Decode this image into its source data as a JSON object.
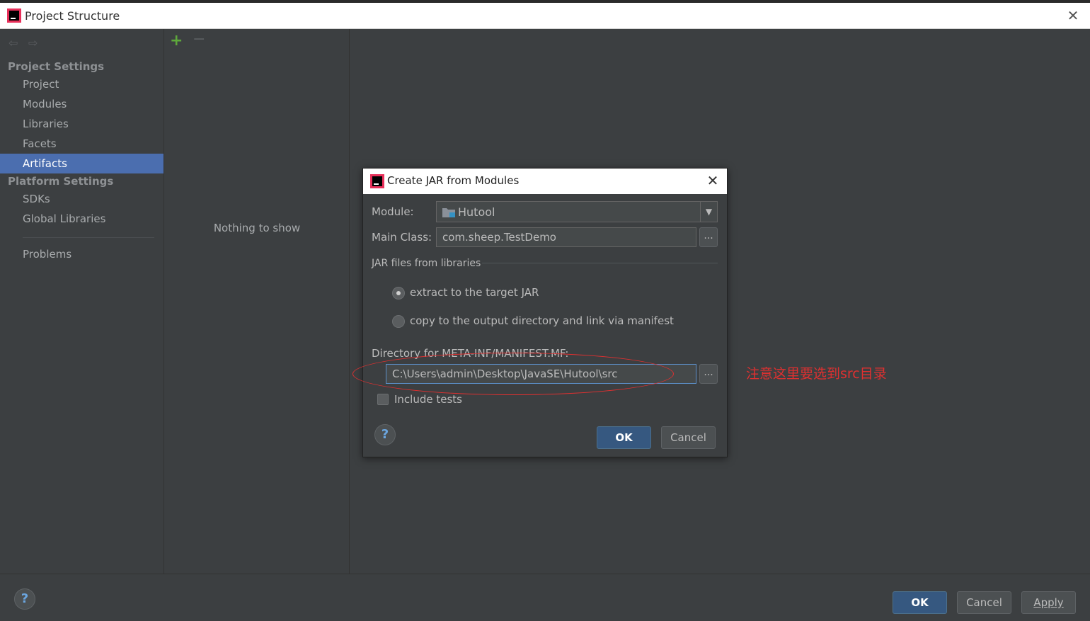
{
  "window": {
    "title": "Project Structure"
  },
  "nav": {
    "project_settings_header": "Project Settings",
    "items_project": [
      "Project",
      "Modules",
      "Libraries",
      "Facets",
      "Artifacts"
    ],
    "platform_settings_header": "Platform Settings",
    "items_platform": [
      "SDKs",
      "Global Libraries"
    ],
    "problems": "Problems",
    "active": "Artifacts"
  },
  "middle": {
    "empty_text": "Nothing to show"
  },
  "bottom": {
    "help": "?",
    "ok": "OK",
    "cancel": "Cancel",
    "apply": "Apply"
  },
  "dialog": {
    "title": "Create JAR from Modules",
    "module_label": "Module:",
    "module_value": "Hutool",
    "main_class_label": "Main Class:",
    "main_class_value": "com.sheep.TestDemo",
    "jar_group_label": "JAR files from libraries",
    "radio_extract": "extract to the target JAR",
    "radio_copy": "copy to the output directory and link via manifest",
    "manifest_dir_label": "Directory for META-INF/MANIFEST.MF:",
    "manifest_dir_value": "C:\\Users\\admin\\Desktop\\JavaSE\\Hutool\\src",
    "include_tests": "Include tests",
    "browse": "...",
    "help": "?",
    "ok": "OK",
    "cancel": "Cancel"
  },
  "annotation": {
    "text": "注意这里要选到src目录",
    "color": "#e03030"
  },
  "colors": {
    "selection": "#4b6eaf",
    "primary_button": "#365880",
    "add_icon": "#5ea83b"
  }
}
